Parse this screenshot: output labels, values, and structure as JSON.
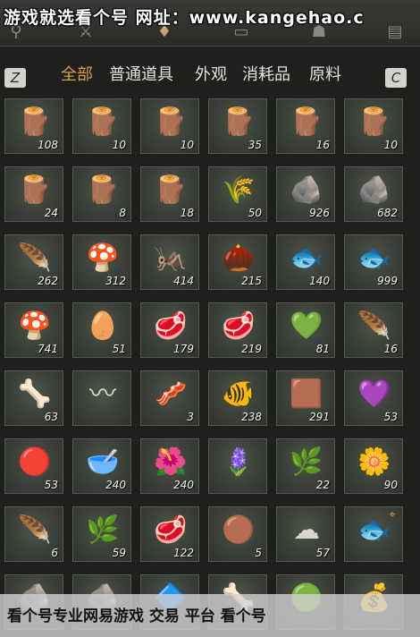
{
  "watermark_top": "游戏就选看个号 网址：www.kangehao.c",
  "watermark_bottom": "看个号专业网易游戏 交易 平台 看个号",
  "top_icons": [
    "search-icon",
    "crossed-swords-icon",
    "money-bag-icon",
    "chest-icon",
    "armor-icon",
    "scroll-icon"
  ],
  "keys": {
    "left": "Z",
    "right": "C"
  },
  "tabs": [
    "全部",
    "普通道具",
    "外观",
    "消耗品",
    "原料"
  ],
  "active_tab": "全部",
  "items": [
    {
      "icon": "log-pile-icon",
      "count": "108"
    },
    {
      "icon": "log-pile-icon",
      "count": "10"
    },
    {
      "icon": "log-pile-icon",
      "count": "10"
    },
    {
      "icon": "log-pile-icon",
      "count": "35"
    },
    {
      "icon": "log-pile-icon",
      "count": "16"
    },
    {
      "icon": "log-pile-icon",
      "count": "10"
    },
    {
      "icon": "log-pile-icon",
      "count": "24"
    },
    {
      "icon": "log-pile-icon",
      "count": "8"
    },
    {
      "icon": "log-pile-icon",
      "count": "18"
    },
    {
      "icon": "straw-bundle-icon",
      "count": "50"
    },
    {
      "icon": "stone-pile-icon",
      "count": "926"
    },
    {
      "icon": "ore-rock-icon",
      "count": "682"
    },
    {
      "icon": "feather-icon",
      "count": "262"
    },
    {
      "icon": "mushroom-cluster-icon",
      "count": "312"
    },
    {
      "icon": "insect-icon",
      "count": "414"
    },
    {
      "icon": "grain-sack-icon",
      "count": "215"
    },
    {
      "icon": "fish-icon",
      "count": "140"
    },
    {
      "icon": "fish-icon",
      "count": "999"
    },
    {
      "icon": "mushroom-icon",
      "count": "741"
    },
    {
      "icon": "eggs-icon",
      "count": "51"
    },
    {
      "icon": "meat-chunks-icon",
      "count": "179"
    },
    {
      "icon": "meat-steak-icon",
      "count": "219"
    },
    {
      "icon": "jade-stone-icon",
      "count": "81"
    },
    {
      "icon": "feathers-icon",
      "count": "16"
    },
    {
      "icon": "animal-hide-icon",
      "count": "63"
    },
    {
      "icon": "intestine-icon",
      "count": ""
    },
    {
      "icon": "meat-slices-icon",
      "count": "3"
    },
    {
      "icon": "carp-icon",
      "count": "238"
    },
    {
      "icon": "gold-ore-icon",
      "count": "291"
    },
    {
      "icon": "amethyst-crystal-icon",
      "count": "53"
    },
    {
      "icon": "red-gem-icon",
      "count": "53"
    },
    {
      "icon": "mortar-bowl-icon",
      "count": "240"
    },
    {
      "icon": "purple-flower-icon",
      "count": "240"
    },
    {
      "icon": "lavender-plant-icon",
      "count": ""
    },
    {
      "icon": "white-flower-branch-icon",
      "count": "22"
    },
    {
      "icon": "orange-flower-icon",
      "count": "90"
    },
    {
      "icon": "white-feather-icon",
      "count": "6"
    },
    {
      "icon": "dry-twig-icon",
      "count": "59"
    },
    {
      "icon": "raw-meat-cut-icon",
      "count": "122"
    },
    {
      "icon": "brown-fur-icon",
      "count": "5"
    },
    {
      "icon": "white-fleece-icon",
      "count": "57"
    },
    {
      "icon": "grey-fish-icon",
      "count": ""
    },
    {
      "icon": "grey-rock-icon",
      "count": ""
    },
    {
      "icon": "grey-rock-icon",
      "count": ""
    },
    {
      "icon": "blue-ore-icon",
      "count": ""
    },
    {
      "icon": "bone-icon",
      "count": ""
    },
    {
      "icon": "green-orb-icon",
      "count": ""
    },
    {
      "icon": "gold-pouch-icon",
      "count": ""
    }
  ],
  "glyphs": {
    "log-pile-icon": "🪵",
    "straw-bundle-icon": "🌾",
    "stone-pile-icon": "🪨",
    "ore-rock-icon": "🪨",
    "feather-icon": "🪶",
    "mushroom-cluster-icon": "🍄",
    "insect-icon": "🦗",
    "grain-sack-icon": "🌰",
    "fish-icon": "🐟",
    "mushroom-icon": "🍄",
    "eggs-icon": "🥚",
    "meat-chunks-icon": "🥩",
    "meat-steak-icon": "🥩",
    "jade-stone-icon": "💚",
    "feathers-icon": "🪶",
    "animal-hide-icon": "🦴",
    "intestine-icon": "〰",
    "meat-slices-icon": "🥓",
    "carp-icon": "🐠",
    "gold-ore-icon": "🟫",
    "amethyst-crystal-icon": "💜",
    "red-gem-icon": "🔴",
    "mortar-bowl-icon": "🥣",
    "purple-flower-icon": "🌺",
    "lavender-plant-icon": "🪻",
    "white-flower-branch-icon": "🌿",
    "orange-flower-icon": "🌼",
    "white-feather-icon": "🪶",
    "dry-twig-icon": "🌿",
    "raw-meat-cut-icon": "🥩",
    "brown-fur-icon": "🟤",
    "white-fleece-icon": "☁",
    "grey-fish-icon": "🐟",
    "grey-rock-icon": "🪨",
    "blue-ore-icon": "🔷",
    "bone-icon": "🦴",
    "green-orb-icon": "🟢",
    "gold-pouch-icon": "💰"
  },
  "target_marker_item": 41,
  "colors": {
    "accent_tab": "#d9a04a",
    "cell_bg": "#3a4038",
    "count_text": "#f2efe6"
  }
}
